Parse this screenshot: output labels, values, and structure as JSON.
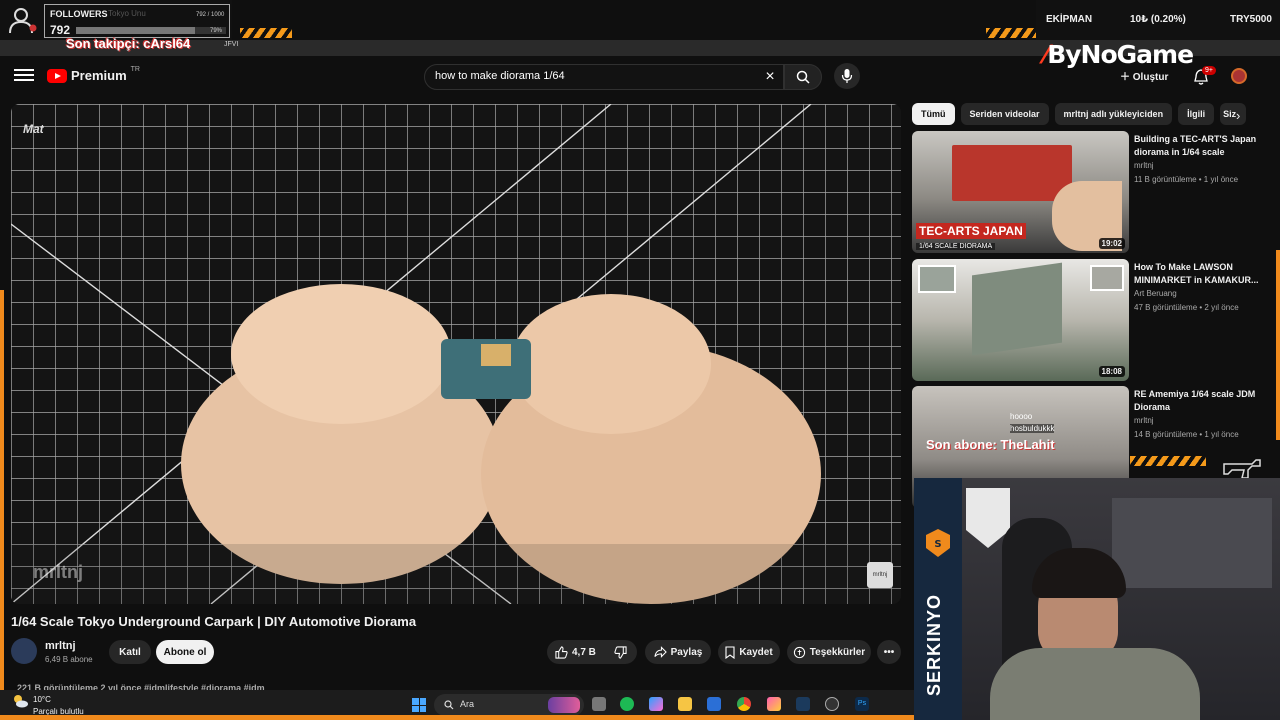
{
  "overlay": {
    "followers_label": "FOLLOWERS",
    "followers_sub": "Tokyo Unu",
    "followers_ratio": "792 / 1000",
    "followers_count": "792",
    "followers_percent": "79%",
    "followers_progress": 0.79,
    "last_follower": "Son takipçi: cArsl64",
    "strip_text": "JFVI",
    "equipment_label": "EKİPMAN",
    "equipment_value": "10₺ (0.20%)",
    "equipment_goal": "TRY5000",
    "brand_left": "ByNo",
    "brand_right": "Game",
    "last_sub": "Son abone: TheLahit",
    "chat_line1": "hoooo",
    "chat_line2": "hosbuldukkk",
    "streamer_name": "SERKINYO"
  },
  "youtube": {
    "logo_word": "Premium",
    "logo_country": "TR",
    "search_query": "how to make diorama 1/64",
    "create_label": "Oluştur",
    "notif_badge": "9+",
    "video": {
      "mat_label": "Mat",
      "watermark": "mrltnj",
      "channel_mark": "mrltnj",
      "title": "1/64 Scale Tokyo Underground Carpark | DIY Automotive Diorama",
      "channel": "mrltnj",
      "subscribers": "6,49 B abone",
      "join_label": "Katıl",
      "subscribe_label": "Abone ol",
      "likes": "4,7 B",
      "share_label": "Paylaş",
      "save_label": "Kaydet",
      "thanks_label": "Teşekkürler",
      "meta": "221 B görüntüleme  2 yıl önce  #idmlifestyle #diorama #idm"
    },
    "chips": [
      "Tümü",
      "Seriden videolar",
      "mrltnj adlı yükleyiciden",
      "İlgili",
      "Siz"
    ],
    "recommendations": [
      {
        "title": "Building a TEC-ART'S Japan diorama in 1/64 scale",
        "channel": "mrltnj",
        "views": "11 B görüntüleme • 1 yıl önce",
        "duration": "19:02",
        "caption": "TEC-ARTS JAPAN",
        "subcaption": "1/64 SCALE DIORAMA"
      },
      {
        "title": "How To Make LAWSON MINIMARKET in KAMAKUR...",
        "channel": "Art Beruang",
        "views": "47 B görüntüleme • 2 yıl önce",
        "duration": "18:08",
        "caption": "",
        "subcaption": ""
      },
      {
        "title": "RE Amemiya 1/64 scale JDM Diorama",
        "channel": "mrltnj",
        "views": "14 B görüntüleme • 1 yıl önce",
        "duration": "",
        "caption": "",
        "subcaption": ""
      }
    ]
  },
  "taskbar": {
    "temperature": "10°C",
    "weather": "Parçalı bulutlu",
    "search_label": "Ara"
  },
  "colors": {
    "accent_orange": "#f08a1c",
    "youtube_red": "#ff0000",
    "background": "#0f0f0f"
  }
}
